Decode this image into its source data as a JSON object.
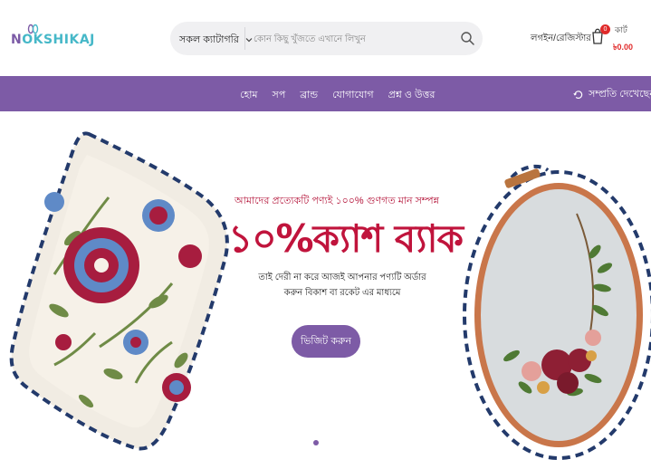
{
  "brand": {
    "logo_text_first": "N",
    "logo_text_rest": "OKSHIKAJ",
    "colors": {
      "primary": "#7d5ba6",
      "accent_red": "#c0143c",
      "logo_teal": "#46b8c8"
    }
  },
  "header": {
    "search": {
      "category_label": "সকল ক্যাটাগরি",
      "placeholder": "কোন কিছু খুঁজতে এখানে লিখুন",
      "icons": {
        "category": "chevron-down-icon",
        "submit": "search-icon"
      }
    },
    "account": {
      "login_label": "লগইন/রেজিস্টার"
    },
    "cart": {
      "label": "কার্ট",
      "count": "0",
      "amount": "৳0.00",
      "icon": "cart-icon"
    }
  },
  "nav": {
    "items": [
      {
        "label": "হোম"
      },
      {
        "label": "সপ"
      },
      {
        "label": "ব্রান্ড"
      },
      {
        "label": "যোগাযোগ"
      },
      {
        "label": "প্রশ্ন ও উত্তর"
      }
    ],
    "recent": {
      "label": "সম্প্রতি দেখেছেন",
      "icon": "history-icon"
    }
  },
  "hero": {
    "tagline": "আমাদের প্রত্যেকটি পণ্যই ১০০% গুণগত মান সম্পন্ন",
    "headline": "১০%ক্যাশ ব্যাক",
    "description_line1": "তাই দেরী না করে আজই আপনার পণ্যটি অর্ডার",
    "description_line2": "করুন বিকাশ বা রকেট এর মাধ্যমে",
    "cta_label": "ভিজিট করুন",
    "slides_total": 1,
    "active_slide": 1
  }
}
